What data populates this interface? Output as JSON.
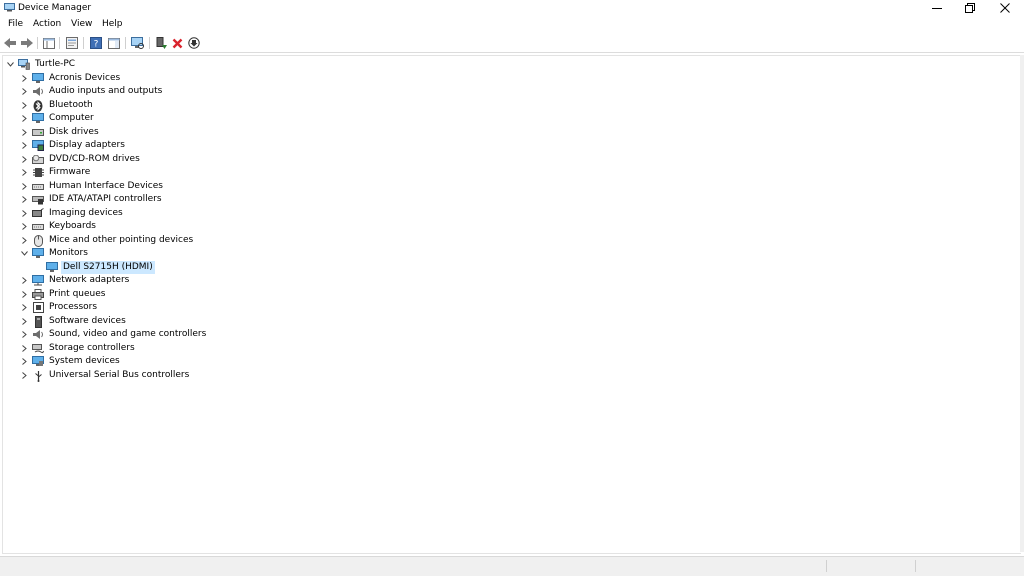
{
  "window": {
    "title": "Device Manager"
  },
  "menu": {
    "items": [
      "File",
      "Action",
      "View",
      "Help"
    ]
  },
  "toolbar": {
    "buttons": [
      "back-icon",
      "forward-icon",
      "show-hide-tree-icon",
      "properties-icon",
      "help-icon",
      "action-pane-icon",
      "scan-hardware-icon",
      "update-driver-icon",
      "uninstall-icon",
      "disable-device-icon"
    ]
  },
  "tree": {
    "root": "Turtle-PC",
    "categories": [
      "Acronis Devices",
      "Audio inputs and outputs",
      "Bluetooth",
      "Computer",
      "Disk drives",
      "Display adapters",
      "DVD/CD-ROM drives",
      "Firmware",
      "Human Interface Devices",
      "IDE ATA/ATAPI controllers",
      "Imaging devices",
      "Keyboards",
      "Mice and other pointing devices",
      "Monitors",
      "Network adapters",
      "Print queues",
      "Processors",
      "Software devices",
      "Sound, video and game controllers",
      "Storage controllers",
      "System devices",
      "Universal Serial Bus controllers"
    ],
    "expanded_category": "Monitors",
    "monitor_child": "Dell S2715H (HDMI)",
    "selected": "Dell S2715H (HDMI)"
  },
  "colors": {
    "selection": "#cce8ff",
    "uninstall_red": "#d9232d",
    "device_blue": "#3a96dd"
  }
}
